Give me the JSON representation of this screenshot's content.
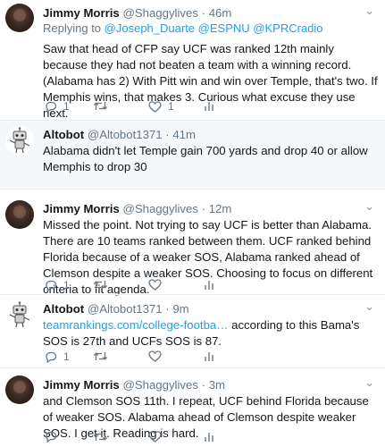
{
  "tweets": [
    {
      "name": "Jimmy Morris",
      "handle": "@Shaggylives",
      "time": "46m",
      "reply_prefix": "Replying to",
      "mentions": [
        "@Joseph_Duarte",
        "@ESPNU",
        "@KPRCradio"
      ],
      "text": "Saw that head of CFP say UCF was ranked 12th mainly because they had not beaten a team with a winning record.  (Alabama has 2) With Pitt win and win over Temple, that's two.  If Memphis wins, that makes 3.  Curious what excuse they use next.",
      "replies": "1",
      "retweets": "",
      "likes": "1"
    },
    {
      "name": "Altobot",
      "handle": "@Altobot1371",
      "time": "41m",
      "text": "Alabama didn't let Temple gain 700 yards and drop 40 or allow Memphis to drop 30"
    },
    {
      "name": "Jimmy Morris",
      "handle": "@Shaggylives",
      "time": "12m",
      "text": "Missed the point.  Not trying to say UCF is better than Alabama.  There are 10 teams ranked between them.  UCF ranked behind Florida because of a weaker SOS, Alabama ranked ahead of Clemson despite a weaker SOS.  Choosing to focus on different criteria to fit agenda.",
      "replies": "1",
      "retweets": "",
      "likes": ""
    },
    {
      "name": "Altobot",
      "handle": "@Altobot1371",
      "time": "9m",
      "link": "teamrankings.com/college-footba…",
      "text": " according to this Bama's SOS is 27th and UCFs SOS is 87.",
      "replies": "1",
      "retweets": "",
      "likes": ""
    },
    {
      "name": "Jimmy Morris",
      "handle": "@Shaggylives",
      "time": "3m",
      "text": "and Clemson SOS 11th.  I repeat, UCF behind Florida because of weaker SOS.  Alabama ahead of Clemson despite weaker SOS.  I get it.  Reading is hard.",
      "replies": "",
      "retweets": "",
      "likes": ""
    }
  ],
  "dot": "·",
  "colors": {
    "link": "#1da1f2",
    "muted": "#657786",
    "highlight_bg": "#f5f8fa"
  },
  "icons": [
    "reply-icon",
    "retweet-icon",
    "like-icon",
    "analytics-icon",
    "chevron-down-icon"
  ]
}
